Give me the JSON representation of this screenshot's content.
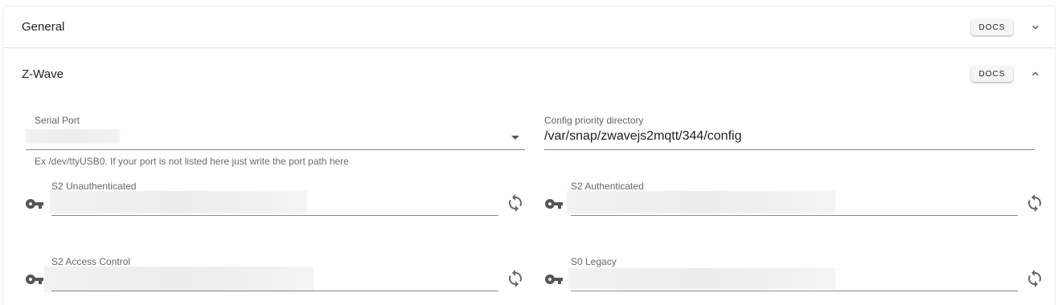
{
  "panels": {
    "general": {
      "title": "General",
      "docs_label": "DOCS",
      "icon": "chevron-down-icon"
    },
    "zwave": {
      "title": "Z-Wave",
      "docs_label": "DOCS",
      "icon": "chevron-up-icon"
    }
  },
  "zwave": {
    "serial_port": {
      "label": "Serial Port",
      "value": "",
      "hint": "Ex /dev/ttyUSB0. If your port is not listed here just write the port path here"
    },
    "config_priority": {
      "label": "Config priority directory",
      "value": "/var/snap/zwavejs2mqtt/344/config"
    },
    "keys": [
      {
        "label": "S2 Unauthenticated",
        "value": ""
      },
      {
        "label": "S2 Authenticated",
        "value": ""
      },
      {
        "label": "S2 Access Control",
        "value": ""
      },
      {
        "label": "S0 Legacy",
        "value": ""
      }
    ]
  },
  "icons": {
    "key": "key-icon",
    "refresh": "refresh-icon"
  }
}
